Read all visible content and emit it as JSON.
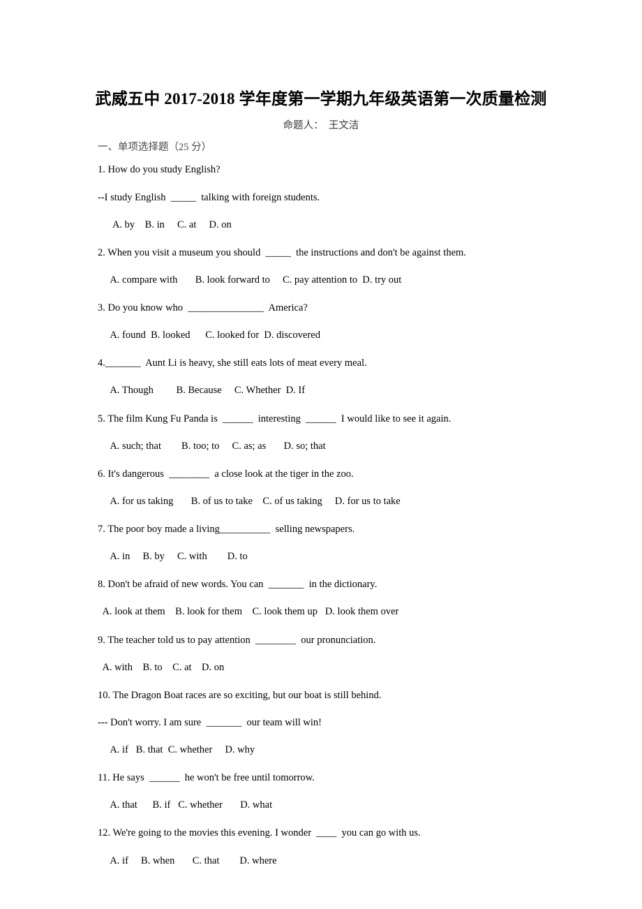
{
  "document": {
    "title": "武威五中 2017-2018 学年度第一学期九年级英语第一次质量检测",
    "byline": "命题人：  王文洁",
    "section_heading": "一、单项选择题（25 分）"
  },
  "questions": [
    {
      "number": "1",
      "stem": "1. How do you study English?",
      "stem2": "--I study English  _____  talking with foreign students.",
      "options": "      A. by    B. in     C. at     D. on"
    },
    {
      "number": "2",
      "stem": "2. When you visit a museum you should  _____  the instructions and don't be against them.",
      "options": "     A. compare with       B. look forward to     C. pay attention to  D. try out"
    },
    {
      "number": "3",
      "stem": "3. Do you know who  _______________  America?",
      "options": "     A. found  B. looked      C. looked for  D. discovered"
    },
    {
      "number": "4",
      "stem": "4._______  Aunt Li is heavy, she still eats lots of meat every meal.",
      "options": "     A. Though         B. Because     C. Whether  D. If"
    },
    {
      "number": "5",
      "stem": "5. The film Kung Fu Panda is  ______  interesting  ______  I would like to see it again.",
      "options": "     A. such; that        B. too; to     C. as; as       D. so; that"
    },
    {
      "number": "6",
      "stem": "6. It's dangerous  ________  a close look at the tiger in the zoo.",
      "options": "     A. for us taking       B. of us to take    C. of us taking     D. for us to take"
    },
    {
      "number": "7",
      "stem": "7. The poor boy made a living__________  selling newspapers.",
      "options": "     A. in     B. by     C. with        D. to"
    },
    {
      "number": "8",
      "stem": "8. Don't be afraid of new words. You can  _______  in the dictionary.",
      "options": "  A. look at them    B. look for them    C. look them up   D. look them over"
    },
    {
      "number": "9",
      "stem": "9. The teacher told us to pay attention  ________  our pronunciation.",
      "options": "  A. with    B. to    C. at    D. on"
    },
    {
      "number": "10",
      "stem": "10. The Dragon Boat races are so exciting, but our boat is still behind.",
      "stem2": "--- Don't worry. I am sure  _______  our team will win!",
      "options": "     A. if   B. that  C. whether     D. why"
    },
    {
      "number": "11",
      "stem": "11. He says  ______  he won't be free until tomorrow.",
      "options": "     A. that      B. if   C. whether       D. what"
    },
    {
      "number": "12",
      "stem": "12. We're going to the movies this evening. I wonder  ____  you can go with us.",
      "options": "     A. if     B. when       C. that        D. where"
    }
  ]
}
